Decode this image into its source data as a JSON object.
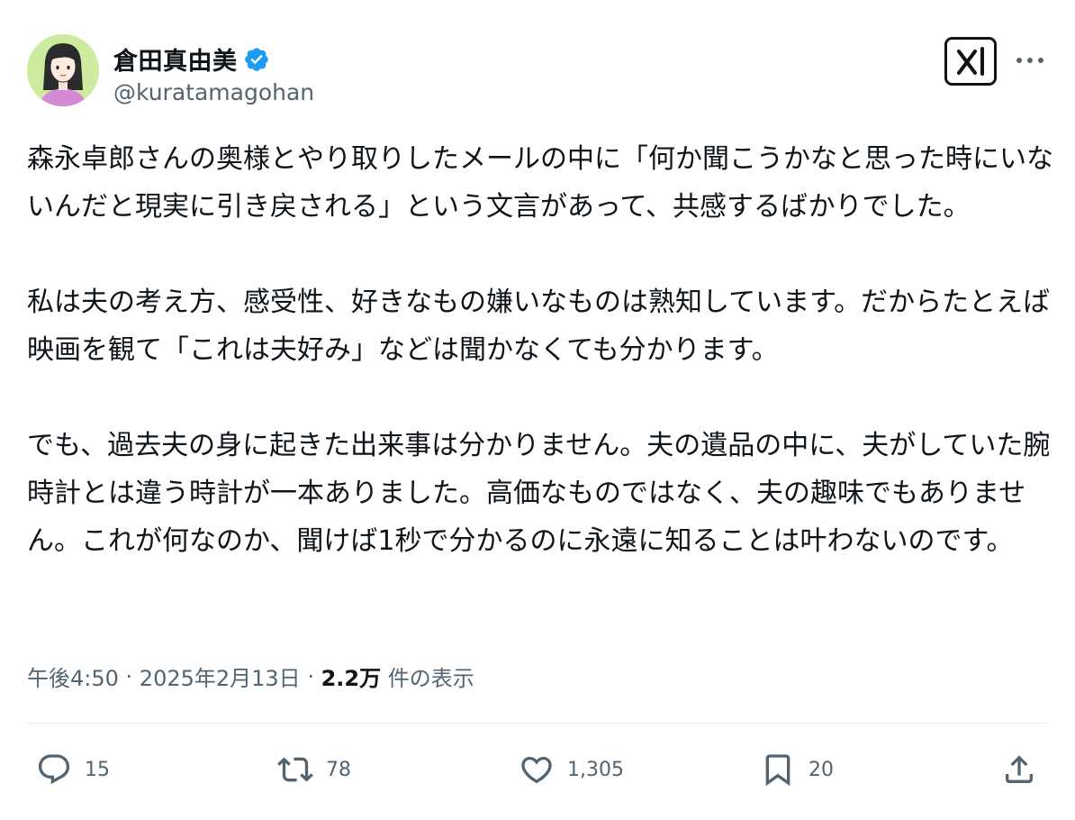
{
  "author": {
    "display_name": "倉田真由美",
    "handle": "@kuratamagohan",
    "verified": true,
    "avatar_icon": "illustrated-woman-avatar"
  },
  "tweet": {
    "text": "森永卓郎さんの奥様とやり取りしたメールの中に「何か聞こうかなと思った時にいないんだと現実に引き戻される」という文言があって、共感するばかりでした。\n\n私は夫の考え方、感受性、好きなもの嫌いなものは熟知しています。だからたとえば映画を観て「これは夫好み」などは聞かなくても分かります。\n\nでも、過去夫の身に起きた出来事は分かりません。夫の遺品の中に、夫がしていた腕時計とは違う時計が一本ありました。高価なものではなく、夫の趣味でもありません。これが何なのか、聞けば1秒で分かるのに永遠に知ることは叶わないのです。",
    "time": "午後4:50",
    "date": "2025年2月13日",
    "separator": " · ",
    "views_count": "2.2万",
    "views_label": " 件の表示"
  },
  "actions": {
    "reply_count": "15",
    "retweet_count": "78",
    "like_count": "1,305",
    "bookmark_count": "20"
  },
  "colors": {
    "text": "#0f1419",
    "secondary": "#536471",
    "verified": "#1d9bf0",
    "avatar_bg": "#cdeca0"
  }
}
